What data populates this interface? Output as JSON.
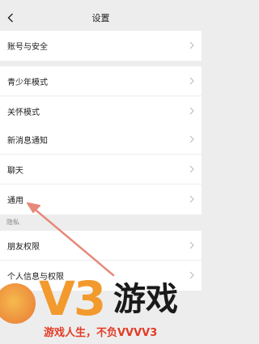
{
  "header": {
    "title": "设置"
  },
  "groups": [
    {
      "items": [
        {
          "label": "账号与安全"
        }
      ]
    },
    {
      "items": [
        {
          "label": "青少年模式"
        },
        {
          "label": "关怀模式"
        }
      ]
    },
    {
      "items": [
        {
          "label": "新消息通知"
        },
        {
          "label": "聊天"
        },
        {
          "label": "通用"
        }
      ]
    }
  ],
  "privacy": {
    "section_label": "隐私",
    "items": [
      {
        "label": "朋友权限"
      },
      {
        "label": "个人信息与权限"
      }
    ]
  },
  "watermark": {
    "brand": "V3",
    "brand_suffix": "游戏",
    "slogan": "游戏人生，不负VVVV3"
  },
  "colors": {
    "background": "#ededed",
    "annotation_arrow": "#e7897a",
    "watermark_orange": "#f29a2e",
    "watermark_red": "#e23b25"
  }
}
